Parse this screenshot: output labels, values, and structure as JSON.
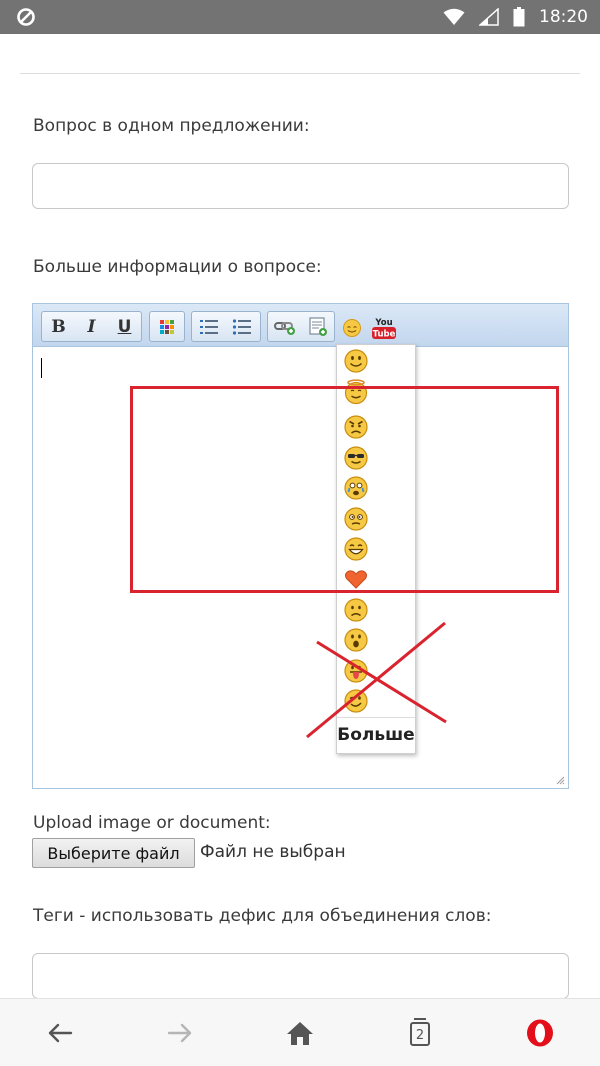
{
  "status_bar": {
    "time": "18:20",
    "icons": [
      "blocked-icon",
      "wifi-icon",
      "signal-icon",
      "battery-icon"
    ]
  },
  "form": {
    "question_label": "Вопрос в одном предложении:",
    "question_value": "",
    "details_label": "Больше информации о вопросе:",
    "upload_label": "Upload image or document:",
    "choose_file_label": "Выберите файл",
    "no_file_label": "Файл не выбран",
    "tags_label": "Теги - использовать дефис для объединения слов:",
    "tags_value": ""
  },
  "editor": {
    "toolbar": {
      "bold": "B",
      "italic": "I",
      "underline": "U",
      "youtube_top": "You",
      "youtube_bottom": "Tube"
    },
    "content": ""
  },
  "smiley_menu": {
    "items": [
      "smile-icon",
      "angel-icon",
      "angry-icon",
      "cool-icon",
      "crying-icon",
      "confused-icon",
      "grin-icon",
      "heart-icon",
      "sad-icon",
      "surprised-icon",
      "tongue-icon",
      "wink-icon"
    ],
    "more_label": "Больше"
  },
  "annotation": {
    "color": "#d9232e"
  },
  "bottom_nav": {
    "tab_count": "2",
    "opera_color": "#e3101b"
  }
}
